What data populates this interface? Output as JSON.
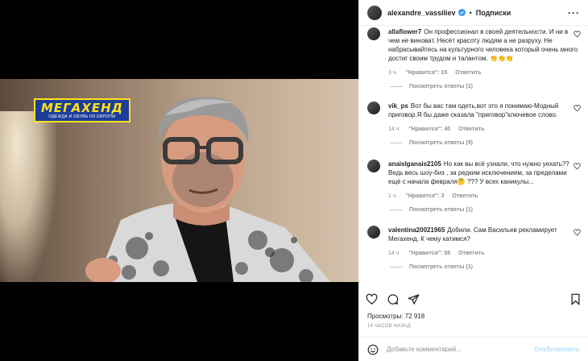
{
  "header": {
    "username": "alexandre_vassiliev",
    "separator": "•",
    "follow_label": "Подписки",
    "more_label": "···"
  },
  "video": {
    "logo_text": "МЕГАХЕНД",
    "logo_subtext": "ОДЕЖДА И ОБУВЬ ИЗ ЕВРОПЫ"
  },
  "comments": [
    {
      "user": "allaflower7",
      "text": "Он профессионал в своей деятельности. И ни в чем не виноват. Несёт красоту людям а не разруху. Не набрасывайтесь на культурного человека который очень много достиг своим трудом и талантом. 👏👏👏",
      "time": "3 ч.",
      "likes": "\"Нравится\": 15",
      "reply": "Ответить",
      "replies": "Посмотреть ответы (1)"
    },
    {
      "user": "vik_ps",
      "text": "Вот бы вас там одеть,вот это я понимаю-Модный приговор.Я бы даже сказала \"приговор\"ключевое слово.",
      "time": "14 ч.",
      "likes": "\"Нравится\": 40",
      "reply": "Ответить",
      "replies": "Посмотреть ответы (9)"
    },
    {
      "user": "anaislganais2105",
      "text": "Но как вы всё узнали, что нужно уехать?? Ведь весь шоу-биз , за редким исключением, за пределами ещё с начала февраля🤔 ??? У всех каникулы...",
      "time": "1 ч.",
      "likes": "\"Нравится\": 3",
      "reply": "Ответить",
      "replies": "Посмотреть ответы (1)"
    },
    {
      "user": "valentina20021965",
      "text": "Добили. Сам Васильев рекламирует Мегахенд. К чему катимся?",
      "time": "14 ч.",
      "likes": "\"Нравится\": 58",
      "reply": "Ответить",
      "replies": "Посмотреть ответы (1)"
    }
  ],
  "stats": {
    "views": "Просмотры: 72 918",
    "timestamp": "14 ЧАСОВ НАЗАД"
  },
  "add_comment": {
    "placeholder": "Добавьте комментарий...",
    "publish_label": "Опубликовать"
  },
  "colors": {
    "verified": "#3897f0",
    "muted_text": "#8e8e8e",
    "publish_disabled": "#b2dffc",
    "logo_bg": "#1c3d9b",
    "logo_text": "#ffe21a"
  }
}
